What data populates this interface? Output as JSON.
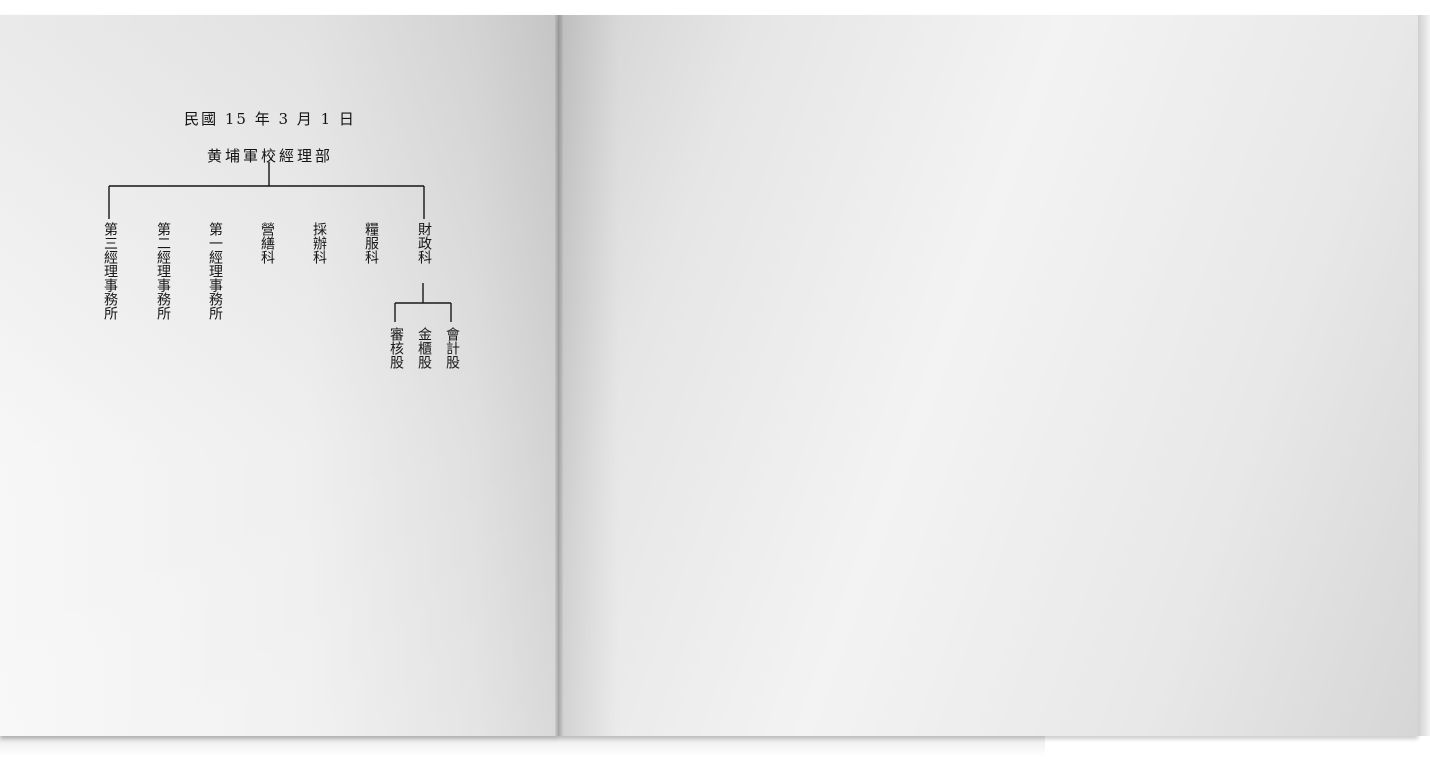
{
  "chart": {
    "date": "民國 15 年 3 月 1 日",
    "root": "黄埔軍校經理部",
    "departments": [
      "第三經理事務所",
      "第二經理事務所",
      "第一經理事務所",
      "營繕科",
      "採辦科",
      "糧服科",
      "財政科"
    ],
    "finance_sections": [
      "審核股",
      "金櫃股",
      "會計股"
    ]
  }
}
